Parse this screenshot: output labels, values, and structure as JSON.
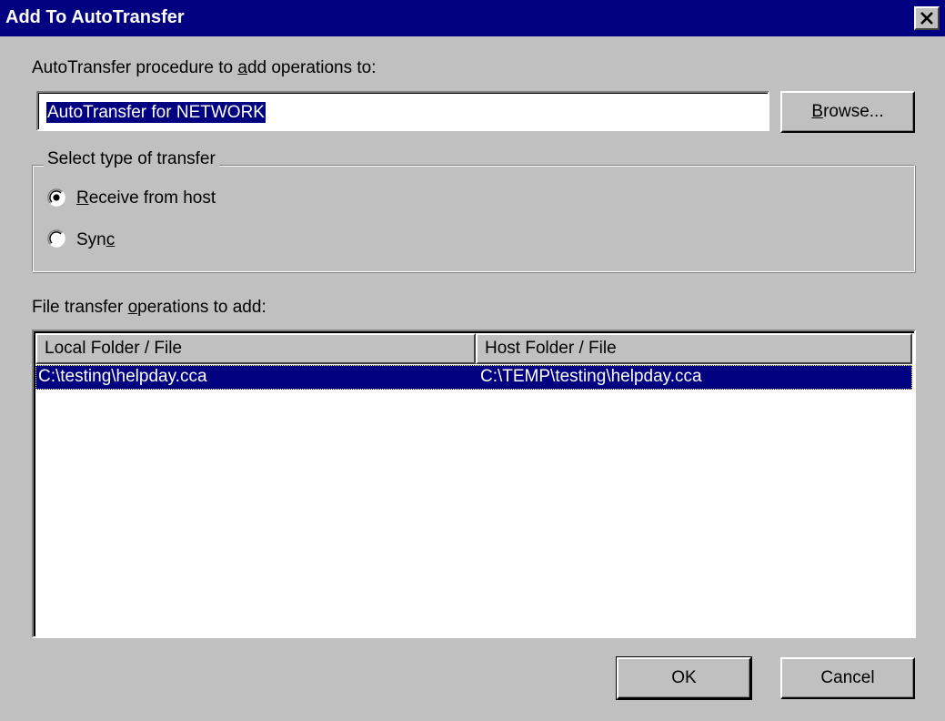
{
  "window": {
    "title": "Add To AutoTransfer",
    "close_icon": "close-icon"
  },
  "procedure": {
    "label_before": "AutoTransfer procedure to ",
    "label_mnemonic": "a",
    "label_after": "dd operations to:",
    "value": "AutoTransfer for NETWORK",
    "browse_mnemonic": "B",
    "browse_rest": "rowse..."
  },
  "transfer_type": {
    "legend": "Select type of transfer",
    "options": [
      {
        "mnemonic": "R",
        "rest": "eceive from host",
        "selected": true
      },
      {
        "before": "Syn",
        "mnemonic": "c",
        "selected": false
      }
    ]
  },
  "operations": {
    "label_before": "File transfer ",
    "label_mnemonic": "o",
    "label_after": "perations to add:",
    "columns": [
      "Local Folder / File",
      "Host Folder / File"
    ],
    "rows": [
      {
        "local": "C:\\testing\\helpday.cca",
        "host": "C:\\TEMP\\testing\\helpday.cca",
        "selected": true
      }
    ]
  },
  "buttons": {
    "ok": "OK",
    "cancel": "Cancel"
  }
}
